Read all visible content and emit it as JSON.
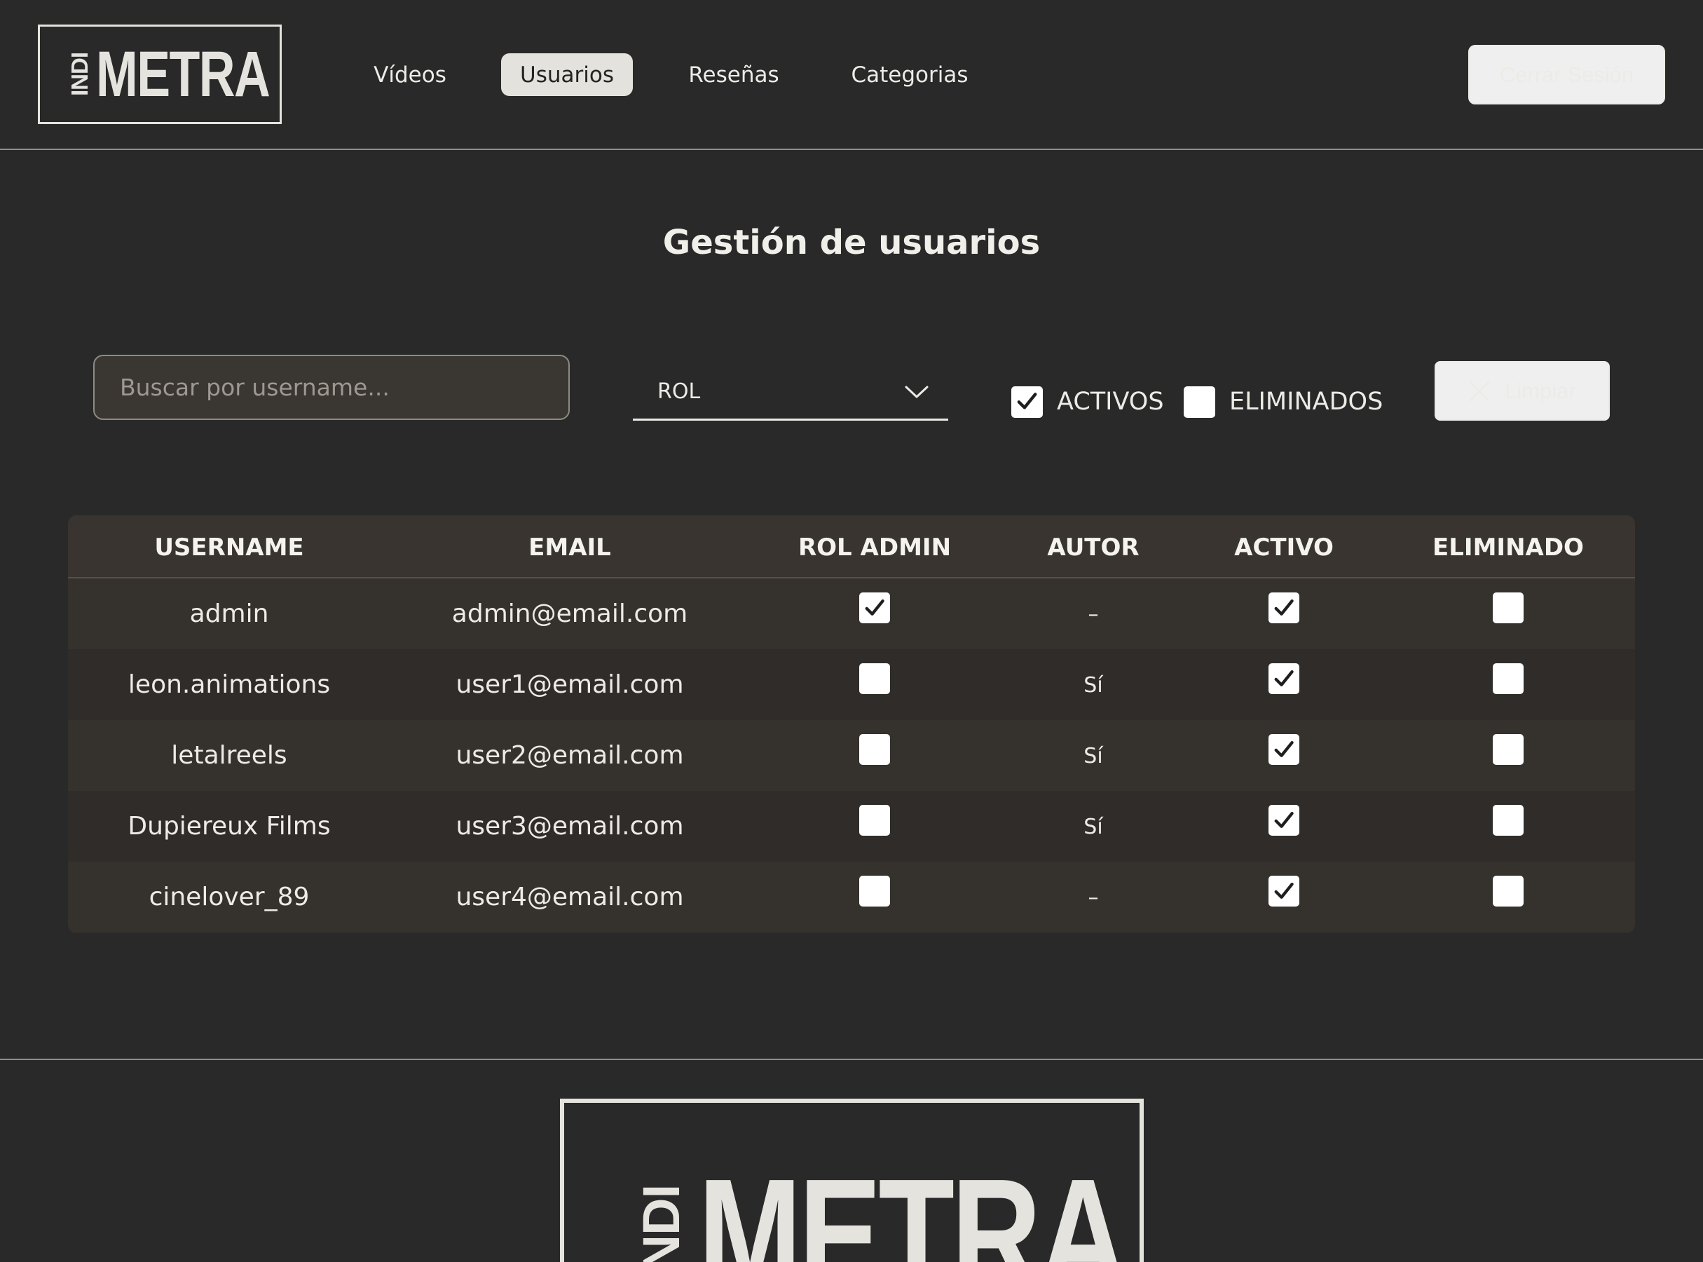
{
  "logo": {
    "small": "INDI",
    "big": "METRA"
  },
  "nav": {
    "items": [
      {
        "label": "Vídeos",
        "active": false
      },
      {
        "label": "Usuarios",
        "active": true
      },
      {
        "label": "Reseñas",
        "active": false
      },
      {
        "label": "Categorias",
        "active": false
      }
    ]
  },
  "header": {
    "logout_label": "Cerrar Sesión"
  },
  "page": {
    "title": "Gestión de usuarios"
  },
  "filters": {
    "search_placeholder": "Buscar por username...",
    "role_label": "ROL",
    "activos_label": "ACTIVOS",
    "activos_checked": true,
    "eliminados_label": "ELIMINADOS",
    "eliminados_checked": false,
    "clear_label": "Limpiar"
  },
  "table": {
    "headers": [
      "USERNAME",
      "EMAIL",
      "ROL ADMIN",
      "AUTOR",
      "ACTIVO",
      "ELIMINADO"
    ],
    "rows": [
      {
        "username": "admin",
        "email": "admin@email.com",
        "rol_admin": true,
        "autor": "–",
        "activo": true,
        "eliminado": false
      },
      {
        "username": "leon.animations",
        "email": "user1@email.com",
        "rol_admin": false,
        "autor": "Sí",
        "activo": true,
        "eliminado": false
      },
      {
        "username": "letalreels",
        "email": "user2@email.com",
        "rol_admin": false,
        "autor": "Sí",
        "activo": true,
        "eliminado": false
      },
      {
        "username": "Dupiereux Films",
        "email": "user3@email.com",
        "rol_admin": false,
        "autor": "Sí",
        "activo": true,
        "eliminado": false
      },
      {
        "username": "cinelover_89",
        "email": "user4@email.com",
        "rol_admin": false,
        "autor": "–",
        "activo": true,
        "eliminado": false
      }
    ]
  },
  "footer": {
    "logo_small": "INDI",
    "logo_big": "METRA"
  },
  "icons": {
    "chevron": "chevron-down-icon",
    "clear": "close-icon",
    "check": "checkmark-icon"
  },
  "colors": {
    "background": "#292929",
    "nav_active_bg": "#e3e2dd",
    "table_bg": "#302d2a",
    "table_header_bg": "#39342f",
    "text": "#ecebe6"
  }
}
